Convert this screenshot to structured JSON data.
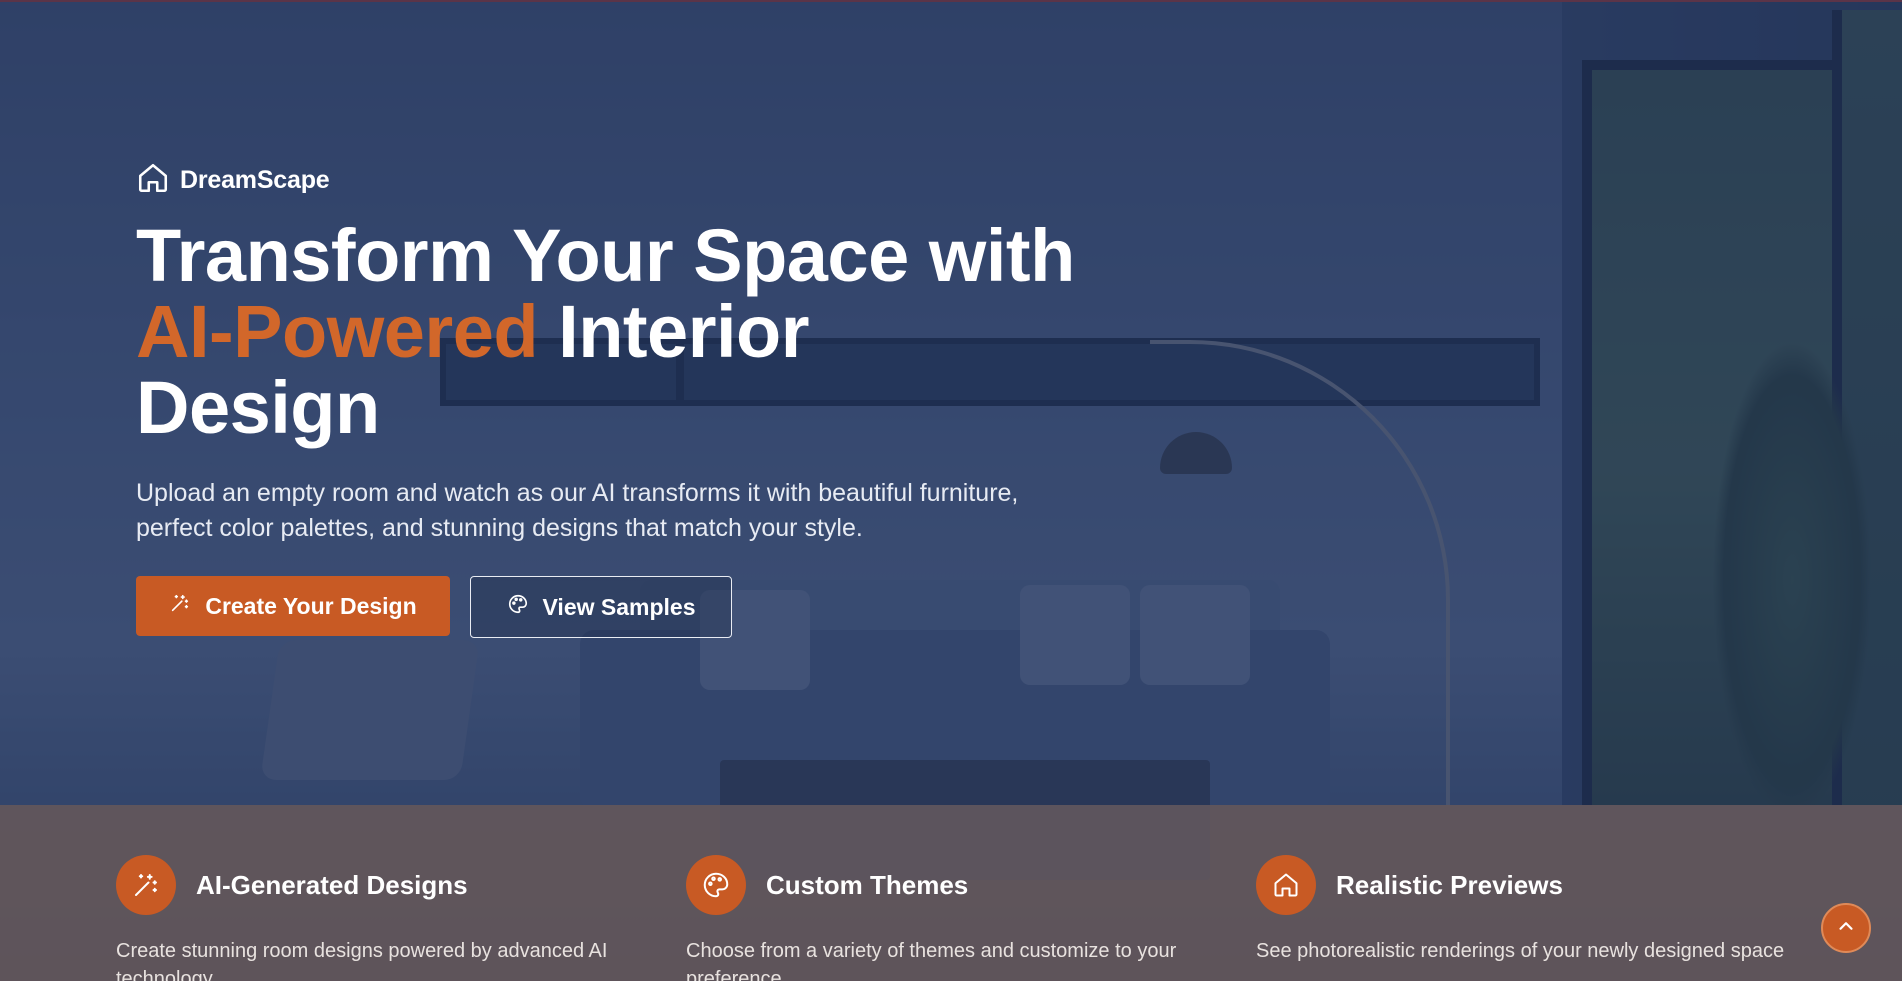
{
  "brand": {
    "name": "DreamScape",
    "icon": "home-icon"
  },
  "hero": {
    "headline_line1": "Transform Your Space with",
    "headline_accent": "AI-Powered",
    "headline_line2_rest": " Interior",
    "headline_line3": "Design",
    "subtitle": "Upload an empty room and watch as our AI transforms it with beautiful furniture, perfect color palettes, and stunning designs that match your style.",
    "primary_button": {
      "label": "Create Your Design",
      "icon": "magic-wand-icon"
    },
    "secondary_button": {
      "label": "View Samples",
      "icon": "palette-icon"
    }
  },
  "features": [
    {
      "title": "AI-Generated Designs",
      "icon": "magic-wand-icon",
      "description": "Create stunning room designs powered by advanced AI technology"
    },
    {
      "title": "Custom Themes",
      "icon": "palette-icon",
      "description": "Choose from a variety of themes and customize to your preference"
    },
    {
      "title": "Realistic Previews",
      "icon": "home-icon",
      "description": "See photorealistic renderings of your newly designed space"
    }
  ],
  "scroll_top": {
    "icon": "chevron-up-icon"
  },
  "colors": {
    "accent": "#c85a24",
    "accent_text": "#d2672a",
    "overlay": "#1e3058"
  }
}
